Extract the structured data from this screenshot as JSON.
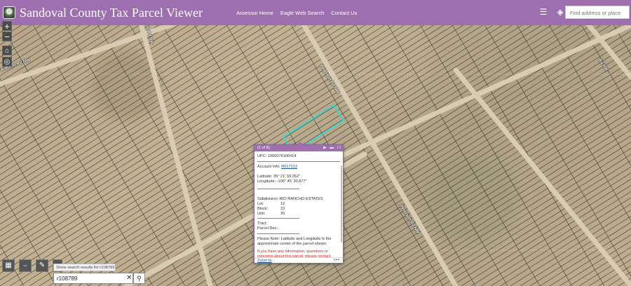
{
  "header": {
    "title": "Sandoval County Tax Parcel Viewer",
    "nav": [
      "Assessor Home",
      "Eagle Web Search",
      "Contact Us"
    ],
    "search_placeholder": "Find address or place"
  },
  "roads": [
    "Peterson Rd NW",
    "Angelo Rd NW",
    "Antonio Rd NW",
    "Rd NW",
    "Peterson Rd NW"
  ],
  "popup": {
    "counter": "(1 of 8)",
    "upc": "UPC: 1000076106414",
    "account_label": "Account Info:",
    "account_value": "R017213",
    "latitude": "Latitude: 35° 21' 33.352\"",
    "longitude": "Longitude: -106° 45' 30.877\"",
    "subdivision": "Subdivision: RIO RANCHO ESTATES",
    "lot_label": "Lot:",
    "lot_value": "12",
    "block_label": "Block:",
    "block_value": "23",
    "unit_label": "Unit:",
    "unit_value": "26",
    "tract": "Tract:",
    "parcel_desc": "Parcel Des.:",
    "note": "Please Note: Latitude and Longitude is the approximate center of the parcel shown.",
    "info": "If you have any information, questions or concerns about this parcel, please contact",
    "zoom": "Zoom to",
    "more": "•••"
  },
  "search_widget": {
    "hint": "Show search results for r108789",
    "value": "r108789"
  },
  "colors": {
    "header": "#9e6fae",
    "parcel_highlight": "#3fd6cf"
  }
}
